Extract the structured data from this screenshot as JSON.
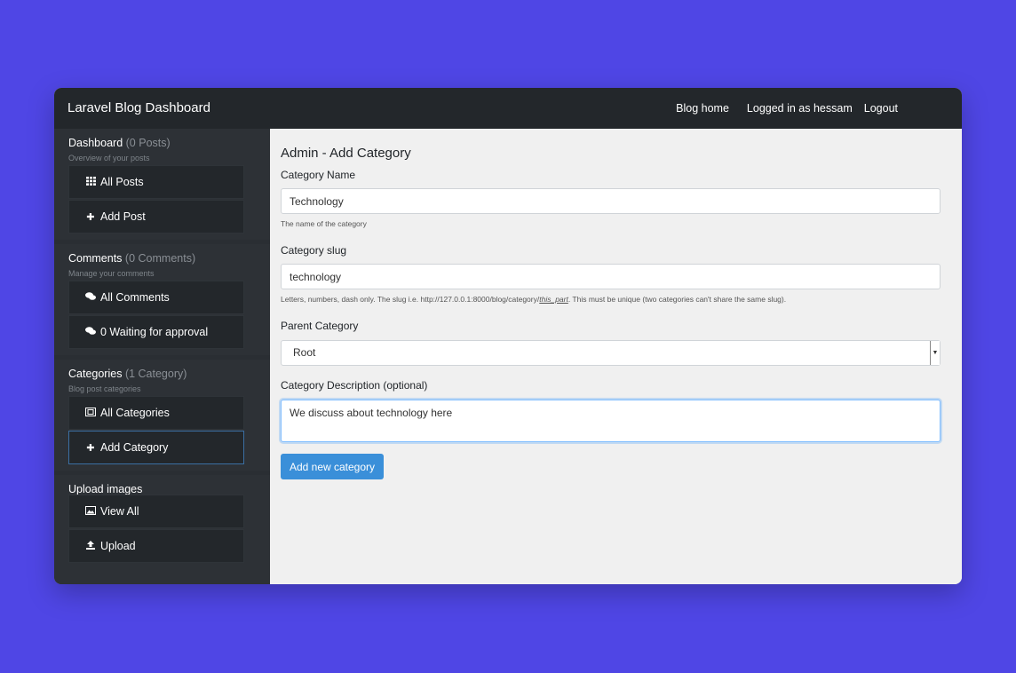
{
  "navbar": {
    "brand": "Laravel Blog Dashboard",
    "blog_home": "Blog home",
    "logged_in": "Logged in as hessam",
    "logout": "Logout"
  },
  "sidebar": {
    "dashboard": {
      "title": "Dashboard",
      "count": "(0 Posts)",
      "sub": "Overview of your posts",
      "items": [
        {
          "label": "All Posts",
          "icon": "grid-icon"
        },
        {
          "label": "Add Post",
          "icon": "plus-icon"
        }
      ]
    },
    "comments": {
      "title": "Comments",
      "count": "(0 Comments)",
      "sub": "Manage your comments",
      "items": [
        {
          "label": "All Comments",
          "icon": "comments-icon"
        },
        {
          "label": "0 Waiting for approval",
          "icon": "comments-icon"
        }
      ]
    },
    "categories": {
      "title": "Categories",
      "count": "(1 Category)",
      "sub": "Blog post categories",
      "items": [
        {
          "label": "All Categories",
          "icon": "image-frame-icon"
        },
        {
          "label": "Add Category",
          "icon": "plus-icon"
        }
      ]
    },
    "uploads": {
      "title": "Upload images",
      "items": [
        {
          "label": "View All",
          "icon": "picture-icon"
        },
        {
          "label": "Upload",
          "icon": "upload-icon"
        }
      ]
    }
  },
  "form": {
    "title": "Admin - Add Category",
    "name_label": "Category Name",
    "name_value": "Technology",
    "name_help": "The name of the category",
    "slug_label": "Category slug",
    "slug_value": "technology",
    "slug_help_pre": "Letters, numbers, dash only. The slug i.e. http://127.0.0.1:8000/blog/category/",
    "slug_help_part": "this_part",
    "slug_help_post": ". This must be unique (two categories can't share the same slug).",
    "parent_label": "Parent Category",
    "parent_value": "Root",
    "desc_label": "Category Description (optional)",
    "desc_value": "We discuss about technology here",
    "submit": "Add new category"
  }
}
